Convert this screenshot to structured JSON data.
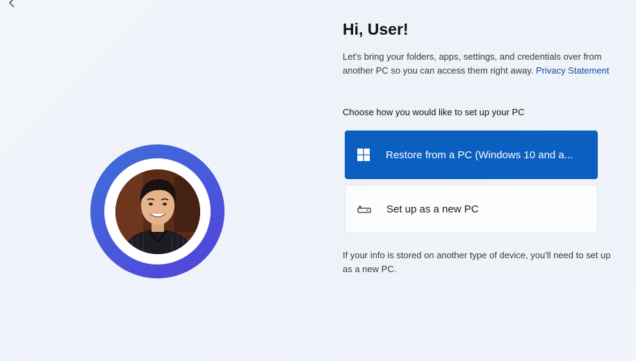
{
  "nav": {
    "back_icon": "back-arrow-icon"
  },
  "greeting": "Hi, User!",
  "intro": {
    "text": "Let's bring your folders, apps, settings, and credentials over from another PC so you can access them right away. ",
    "link_label": "Privacy Statement"
  },
  "prompt": "Choose how you would like to set up your PC",
  "options": [
    {
      "label": "Restore from a PC (Windows 10 and a...",
      "icon": "windows-logo-icon",
      "selected": true
    },
    {
      "label": "Set up as a new PC",
      "icon": "new-pc-icon",
      "selected": false
    }
  ],
  "note": "If your info is stored on another type of device, you'll need to set up as a new PC.",
  "colors": {
    "accent": "#0a5fc0",
    "avatar_ring": "#4a55dc",
    "link": "#0b4f9c"
  }
}
